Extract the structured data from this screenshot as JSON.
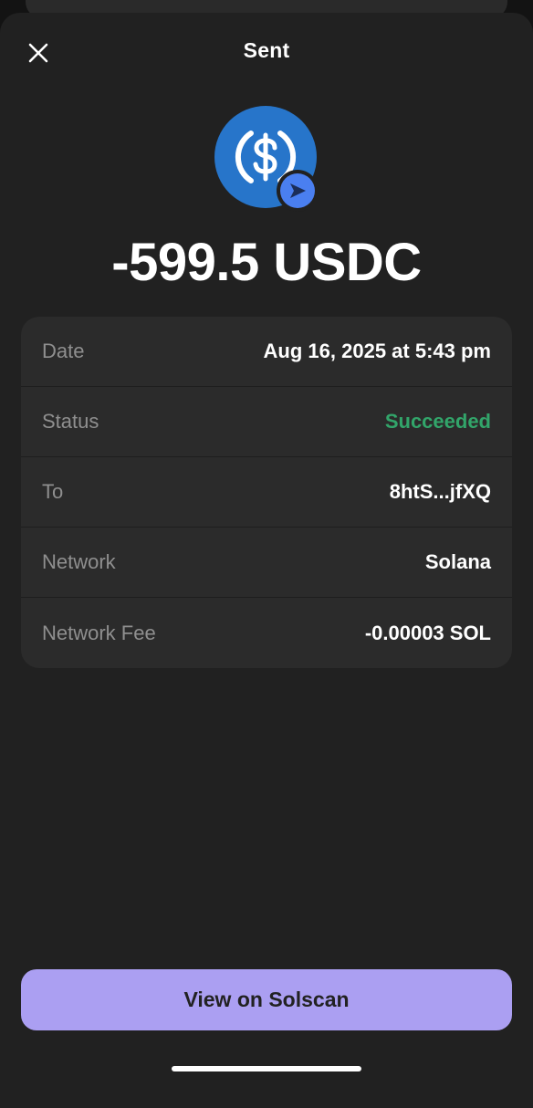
{
  "header": {
    "title": "Sent",
    "close_icon": "close-icon"
  },
  "token": {
    "icon": "usdc-dollar-icon",
    "badge_icon": "send-arrow-icon",
    "brand_color": "#2775ca",
    "badge_color": "#4a7ff0"
  },
  "amount": "-599.5 USDC",
  "details": {
    "rows": [
      {
        "label": "Date",
        "value": "Aug 16, 2025 at 5:43 pm"
      },
      {
        "label": "Status",
        "value": "Succeeded",
        "color": "#32a56a"
      },
      {
        "label": "To",
        "value": "8htS...jfXQ"
      },
      {
        "label": "Network",
        "value": "Solana"
      },
      {
        "label": "Network Fee",
        "value": "-0.00003 SOL"
      }
    ]
  },
  "actions": {
    "view_button_label": "View on Solscan",
    "accent_color": "#ab9ff2"
  }
}
